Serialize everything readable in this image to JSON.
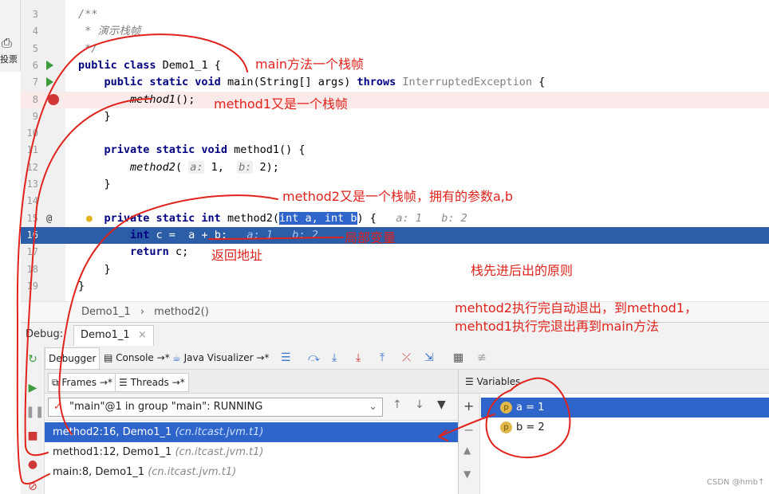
{
  "left_panel": {
    "vote_label": "投票",
    "vote_icon": "vote-icon"
  },
  "editor": {
    "lines": [
      {
        "num": "3",
        "parts": [
          [
            "cm",
            "/**"
          ]
        ]
      },
      {
        "num": "4",
        "parts": [
          [
            "cm",
            " * 演示栈帧"
          ]
        ]
      },
      {
        "num": "5",
        "parts": [
          [
            "cm",
            " */"
          ]
        ]
      },
      {
        "num": "6",
        "parts": [
          [
            "kw",
            "public class "
          ],
          [
            "",
            "Demo1_1 {"
          ]
        ]
      },
      {
        "num": "7",
        "parts": [
          [
            "",
            "    "
          ],
          [
            "kw",
            "public static void "
          ],
          [
            "",
            "main(String[] args) "
          ],
          [
            "kw",
            "throws "
          ],
          [
            "gr",
            "InterruptedException"
          ],
          [
            "",
            " {"
          ]
        ]
      },
      {
        "num": "8",
        "parts": [
          [
            "",
            "        "
          ],
          [
            "it",
            "method1"
          ],
          [
            "",
            "();"
          ]
        ]
      },
      {
        "num": "9",
        "parts": [
          [
            "",
            "    }"
          ]
        ]
      },
      {
        "num": "10",
        "parts": [
          [
            "",
            ""
          ]
        ]
      },
      {
        "num": "11",
        "parts": [
          [
            "",
            "    "
          ],
          [
            "kw",
            "private static void "
          ],
          [
            "",
            "method1() {"
          ]
        ]
      },
      {
        "num": "12",
        "parts": [
          [
            "",
            "        "
          ],
          [
            "it",
            "method2"
          ],
          [
            "",
            "( "
          ],
          [
            "hint",
            "a:"
          ],
          [
            "",
            " 1,  "
          ],
          [
            "hint",
            "b:"
          ],
          [
            "",
            " 2);"
          ]
        ]
      },
      {
        "num": "13",
        "parts": [
          [
            "",
            "    }"
          ]
        ]
      },
      {
        "num": "14",
        "parts": [
          [
            "",
            ""
          ]
        ]
      },
      {
        "num": "15",
        "parts": [
          [
            "",
            "    "
          ],
          [
            "kw",
            "private static int "
          ],
          [
            "",
            "method2("
          ],
          [
            "sel",
            "int a, int b"
          ],
          [
            "",
            ") {   "
          ],
          [
            "hint-inline",
            "a: 1   b: 2"
          ]
        ]
      },
      {
        "num": "16",
        "parts": [
          [
            "",
            "        "
          ],
          [
            "kw",
            "int "
          ],
          [
            "",
            "c =  a + b;   "
          ],
          [
            "hint-inline",
            "a: 1   b: 2"
          ]
        ]
      },
      {
        "num": "17",
        "parts": [
          [
            "",
            "        "
          ],
          [
            "kw",
            "return "
          ],
          [
            "",
            "c;"
          ]
        ]
      },
      {
        "num": "18",
        "parts": [
          [
            "",
            "    }"
          ]
        ]
      },
      {
        "num": "19",
        "parts": [
          [
            "",
            "}"
          ]
        ]
      }
    ]
  },
  "breadcrumb": {
    "class_name": "Demo1_1",
    "separator": "›",
    "method_name": "method2()"
  },
  "debug": {
    "label": "Debug:",
    "tab": "Demo1_1",
    "tab_close": "×",
    "toolbar": {
      "debugger": "Debugger",
      "console": "Console",
      "console_arrow": "→*",
      "visualizer": "Java Visualizer",
      "visualizer_arrow": "→*"
    },
    "frames_tab": "Frames",
    "frames_arrow": "→*",
    "threads_tab": "Threads",
    "threads_arrow": "→*",
    "thread_select": "\"main\"@1 in group \"main\": RUNNING",
    "frames": [
      {
        "label": "method2:16, Demo1_1 ",
        "pkg": "(cn.itcast.jvm.t1)"
      },
      {
        "label": "method1:12, Demo1_1 ",
        "pkg": "(cn.itcast.jvm.t1)"
      },
      {
        "label": "main:8, Demo1_1 ",
        "pkg": "(cn.itcast.jvm.t1)"
      }
    ],
    "variables_tab": "Variables",
    "variables": [
      {
        "badge": "p",
        "text": "a = 1"
      },
      {
        "badge": "p",
        "text": "b = 2"
      }
    ]
  },
  "annotations": {
    "main_frame": "main方法一个栈帧",
    "method1_frame": "method1又是一个栈帧",
    "method2_frame": "method2又是一个栈帧，拥有的参数a,b",
    "local_var": "局部变量",
    "return_addr": "返回地址",
    "lifo": "栈先进后出的原则",
    "exit_line1": "mehtod2执行完自动退出，到method1，",
    "exit_line2": "mehtod1执行完退出再到main方法"
  },
  "watermark": "CSDN @hmb↑",
  "colors": {
    "selection": "#2f65ca",
    "annotation": "#e0231c",
    "keyword": "#000080"
  }
}
